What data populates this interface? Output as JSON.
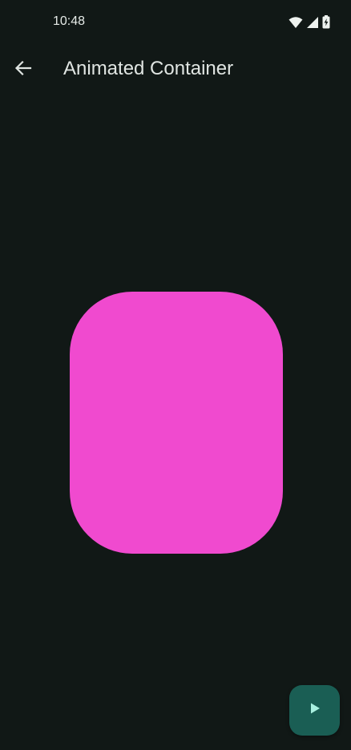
{
  "status_bar": {
    "time": "10:48",
    "icons": [
      "wifi-icon",
      "signal-icon",
      "battery-charging-icon"
    ]
  },
  "app_bar": {
    "back_icon": "arrow-back-icon",
    "title": "Animated Container"
  },
  "container": {
    "color": "#f04acf"
  },
  "fab": {
    "icon": "play-icon",
    "background": "#1a5e54",
    "icon_color": "#a9f0e0"
  },
  "theme": {
    "background": "#111816",
    "text": "#e0e5e2"
  }
}
